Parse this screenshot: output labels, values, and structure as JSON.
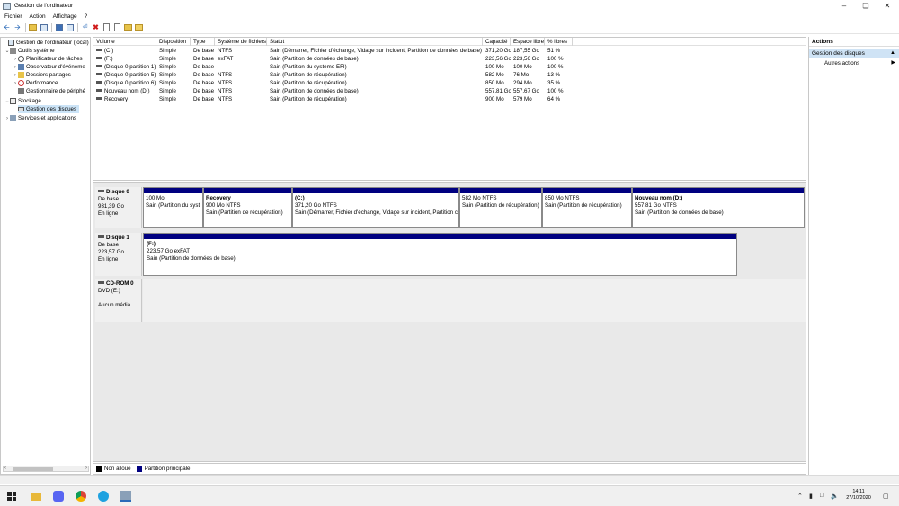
{
  "window": {
    "title": "Gestion de l'ordinateur"
  },
  "menu": {
    "items": [
      "Fichier",
      "Action",
      "Affichage",
      "?"
    ]
  },
  "tree": {
    "items": [
      {
        "label": "Gestion de l'ordinateur (local)",
        "level": 0
      },
      {
        "label": "Outils système",
        "level": 1
      },
      {
        "label": "Planificateur de tâches",
        "level": 2
      },
      {
        "label": "Observateur d'événeme",
        "level": 2
      },
      {
        "label": "Dossiers partagés",
        "level": 2
      },
      {
        "label": "Performance",
        "level": 2
      },
      {
        "label": "Gestionnaire de périphé",
        "level": 2
      },
      {
        "label": "Stockage",
        "level": 1
      },
      {
        "label": "Gestion des disques",
        "level": 2
      },
      {
        "label": "Services et applications",
        "level": 1
      }
    ]
  },
  "volumes": {
    "headers": [
      "Volume",
      "Disposition",
      "Type",
      "Système de fichiers",
      "Statut",
      "Capacité",
      "Espace libre",
      "% libres"
    ],
    "rows": [
      [
        "(C:)",
        "Simple",
        "De base",
        "NTFS",
        "Sain (Démarrer, Fichier d'échange, Vidage sur incident, Partition de données de base)",
        "371,20 Go",
        "187,55 Go",
        "51 %"
      ],
      [
        "(F:)",
        "Simple",
        "De base",
        "exFAT",
        "Sain (Partition de données de base)",
        "223,56 Go",
        "223,56 Go",
        "100 %"
      ],
      [
        "(Disque 0 partition 1)",
        "Simple",
        "De base",
        "",
        "Sain (Partition du système EFI)",
        "100 Mo",
        "100 Mo",
        "100 %"
      ],
      [
        "(Disque 0 partition 5)",
        "Simple",
        "De base",
        "NTFS",
        "Sain (Partition de récupération)",
        "582 Mo",
        "76 Mo",
        "13 %"
      ],
      [
        "(Disque 0 partition 6)",
        "Simple",
        "De base",
        "NTFS",
        "Sain (Partition de récupération)",
        "850 Mo",
        "294 Mo",
        "35 %"
      ],
      [
        "Nouveau nom (D:)",
        "Simple",
        "De base",
        "NTFS",
        "Sain (Partition de données de base)",
        "557,81 Go",
        "557,67 Go",
        "100 %"
      ],
      [
        "Recovery",
        "Simple",
        "De base",
        "NTFS",
        "Sain (Partition de récupération)",
        "900 Mo",
        "579 Mo",
        "64 %"
      ]
    ]
  },
  "disks": [
    {
      "name": "Disque 0",
      "type": "De base",
      "size": "931,39 Go",
      "status": "En ligne",
      "partitions": [
        {
          "name": "",
          "size": "100 Mo",
          "status": "Sain (Partition du syst"
        },
        {
          "name": "Recovery",
          "size": "900 Mo NTFS",
          "status": "Sain (Partition de récupération)"
        },
        {
          "name": "(C:)",
          "size": "371,20 Go NTFS",
          "status": "Sain (Démarrer, Fichier d'échange, Vidage sur incident, Partition c"
        },
        {
          "name": "",
          "size": "582 Mo NTFS",
          "status": "Sain (Partition de récupération)"
        },
        {
          "name": "",
          "size": "850 Mo NTFS",
          "status": "Sain (Partition de récupération)"
        },
        {
          "name": "Nouveau nom  (D:)",
          "size": "557,81 Go NTFS",
          "status": "Sain (Partition de données de base)"
        }
      ]
    },
    {
      "name": "Disque 1",
      "type": "De base",
      "size": "223,57 Go",
      "status": "En ligne",
      "partitions": [
        {
          "name": "(F:)",
          "size": "223,57 Go exFAT",
          "status": "Sain (Partition de données de base)"
        }
      ]
    },
    {
      "name": "CD-ROM 0",
      "type": "DVD (E:)",
      "size": "",
      "status": "Aucun média",
      "partitions": []
    }
  ],
  "legend": {
    "unallocated": "Non alloué",
    "primary": "Partition principale",
    "unallocated_color": "#000000",
    "primary_color": "#000080"
  },
  "actions": {
    "title": "Actions",
    "section": "Gestion des disques",
    "more": "Autres actions"
  },
  "taskbar": {
    "time": "14:11",
    "date": "27/10/2020"
  }
}
